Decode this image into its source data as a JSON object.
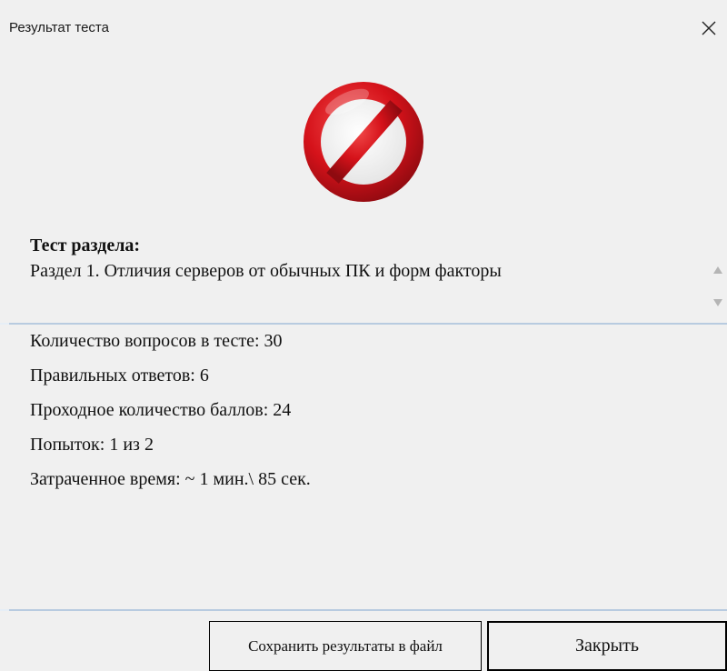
{
  "window": {
    "title": "Результат теста"
  },
  "icons": {
    "close": "close-icon",
    "result": "prohibited-icon",
    "scroll_up": "scroll-up-arrow-icon",
    "scroll_down": "scroll-down-arrow-icon"
  },
  "colors": {
    "prohibited_red": "#d5121a",
    "divider": "#b8cbe0",
    "background": "#f0f0f0"
  },
  "test": {
    "label": "Тест раздела:",
    "section_name": "Раздел 1. Отличия серверов от обычных ПК и форм факторы"
  },
  "stats": {
    "questions_total": "Количество вопросов в тесте: 30",
    "correct_answers": "Правильных ответов: 6",
    "passing_score": "Проходное количество баллов: 24",
    "attempts": "Попыток: 1 из 2",
    "time_spent": "Затраченное время: ~ 1 мин.\\ 85 сек."
  },
  "buttons": {
    "save": "Сохранить результаты в файл",
    "close": "Закрыть"
  }
}
